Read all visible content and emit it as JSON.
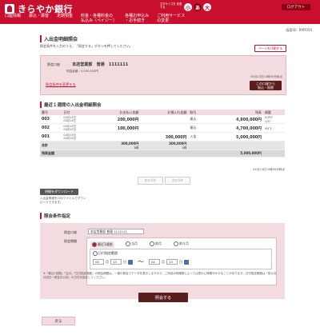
{
  "header": {
    "bank_name": "きらやか銀行",
    "font_size_caption": "文字サイズを\n変更する",
    "font_sizes": [
      "小",
      "あ",
      "大"
    ],
    "logout": "ログアウト",
    "nav": [
      "口座情報",
      "振込・振替",
      "定期預金",
      "料金・各種料金の\n払込み（ペイジー）",
      "各種お申込み\n・お手続き",
      "ご利用サービス\nの変更"
    ]
  },
  "user_id": "画面ID：RMY050",
  "page": {
    "title": "入出金明細照会",
    "instruction": "照会条件を入力のうえ、「照会する」ボタンを押してください。",
    "print_button": "ページを印刷する"
  },
  "account": {
    "label": "照会口座",
    "branch": "本店営業部",
    "type": "普通",
    "number": "1111111",
    "balance_text": "残高金額：5,000,000円",
    "timestamp": "04月13日10時00分時点",
    "change_link": "照会条件を変更する",
    "transfer_button": "この口座から\n振込・振替"
  },
  "transactions": {
    "section_title": "最近１週間の入出金明細照会",
    "headers": [
      "番号",
      "日付",
      "お支払い金額",
      "お預入れ金額",
      "取引",
      "残高",
      "摘要"
    ],
    "rows": [
      {
        "no": "003",
        "date": "04月13日",
        "date2": "04月13日",
        "pay": "200,000円",
        "dep": "",
        "type": "振込",
        "balance": "4,800,000円",
        "memo": "ｶ)ｺｳﾔﾏ\nｼｮｳｼﾞ"
      },
      {
        "no": "002",
        "date": "04月13日",
        "date2": "04月13日",
        "pay": "100,000円",
        "dep": "",
        "type": "振込",
        "balance": "4,700,000円",
        "memo": "ﾔﾏｶﾞﾀ"
      },
      {
        "no": "001",
        "date": "04月13日",
        "date2": "04月13日",
        "pay": "",
        "dep": "300,000円",
        "type": "入金",
        "balance": "5,000,000円",
        "memo": ""
      }
    ],
    "total_label": "合計",
    "total_pay": "300,000円",
    "total_pay_count": "2件",
    "total_dep": "300,000円",
    "total_dep_count": "1件",
    "balance_label": "残高金額",
    "balance_value": "5,000,000円",
    "asof": "04月13日10時00分時点",
    "prev": "前の5件",
    "next": "次の5件"
  },
  "csv": {
    "button": "明細をダウンロード",
    "note": "入出金明細をCSVファイルでダウンロードできます。"
  },
  "conditions": {
    "section_title": "照会条件指定",
    "account_label": "照会口座",
    "account_value": "本店営業部 普通 1111111",
    "period_label": "照会期間",
    "options": [
      "最近1週間",
      "当月",
      "前月",
      "前々月"
    ],
    "date_option": "日付指定範囲",
    "from_month": "04",
    "from_day": "13",
    "to_month": "04",
    "to_day": "13",
    "month": "月",
    "day": "日",
    "tilde": "〜",
    "hint": "※「最近1週間」「当月」「日付指定範囲」の照会期間は、一度の照会でデータを表示しますので、ご利用の明細数によっては表示に時間がかかることがあります。日付指定範囲は「前々月月初日〜照会日以前」の日付を指定してください。",
    "search_button": "照会する"
  },
  "back": "戻る"
}
